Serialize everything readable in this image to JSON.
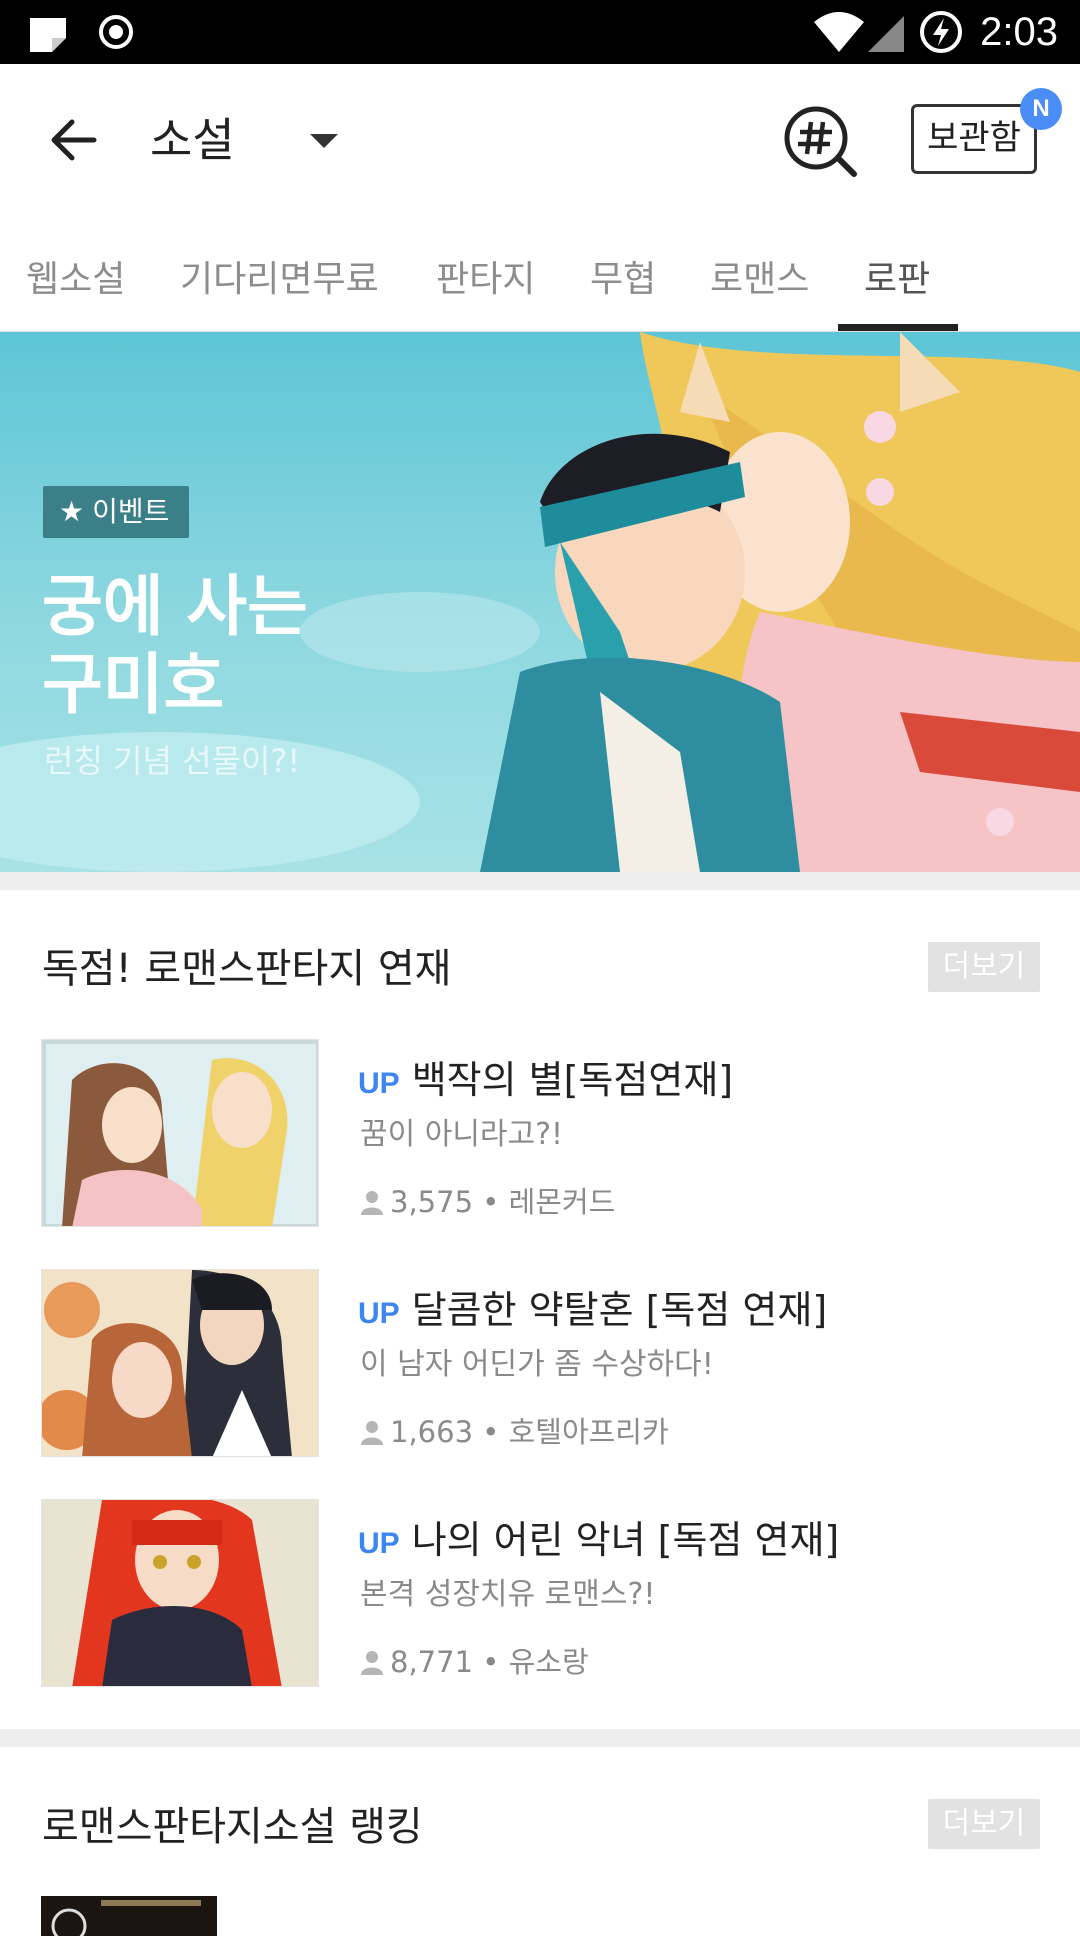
{
  "status_bar": {
    "time": "2:03"
  },
  "header": {
    "title": "소설",
    "library_label": "보관함",
    "library_badge": "N"
  },
  "tabs": [
    {
      "label": "웹소설",
      "active": false
    },
    {
      "label": "기다리면무료",
      "active": false
    },
    {
      "label": "판타지",
      "active": false
    },
    {
      "label": "무협",
      "active": false
    },
    {
      "label": "로맨스",
      "active": false
    },
    {
      "label": "로판",
      "active": true
    }
  ],
  "banner": {
    "tag": "이벤트",
    "title": "궁에 사는\n구미호",
    "subtitle": "런칭 기념 선물이?!"
  },
  "section1": {
    "title": "독점! 로맨스판타지 연재",
    "more_label": "더보기",
    "items": [
      {
        "badge": "UP",
        "title": "백작의 별[독점연재]",
        "desc": "꿈이 아니라고?!",
        "views": "3,575",
        "author": "레몬커드"
      },
      {
        "badge": "UP",
        "title": "달콤한 약탈혼 [독점 연재]",
        "desc": "이 남자 어딘가 좀 수상하다!",
        "views": "1,663",
        "author": "호텔아프리카"
      },
      {
        "badge": "UP",
        "title": "나의 어린 악녀 [독점 연재]",
        "desc": "본격 성장치유 로맨스?!",
        "views": "8,771",
        "author": "유소랑"
      }
    ]
  },
  "section2": {
    "title": "로맨스판타지소설 랭킹",
    "more_label": "더보기"
  },
  "colors": {
    "accent_blue": "#3d86f2",
    "badge_blue": "#4a8df7",
    "banner_bg": "#5dc5d6"
  }
}
